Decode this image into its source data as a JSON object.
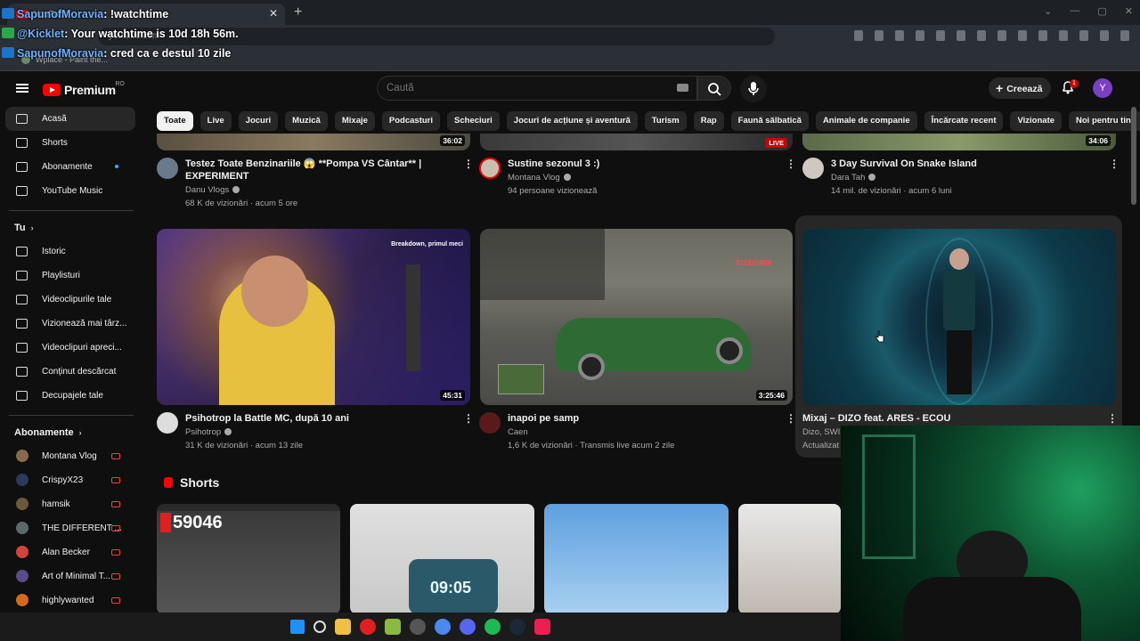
{
  "browser": {
    "tab_title": "YouTube",
    "new_tab": "+",
    "close_tab": "✕",
    "url": "youtube.com",
    "bookmark_label": "Wplace - Paint the..."
  },
  "chat": [
    {
      "user": "SapunofMoravia",
      "msg": ": !watchtime"
    },
    {
      "user": "@Kicklet",
      "msg": ": Your watchtime is 10d 18h 56m."
    },
    {
      "user": "SapunofMoravia",
      "msg": ": cred ca e destul 10 zile"
    }
  ],
  "header": {
    "logo_text": "Premium",
    "logo_region": "RO",
    "search_placeholder": "Caută",
    "create_label": "Creează",
    "notif_count": "1",
    "avatar_letter": "Y"
  },
  "chips": [
    "Toate",
    "Live",
    "Jocuri",
    "Muzică",
    "Mixaje",
    "Podcasturi",
    "Scheciuri",
    "Jocuri de acțiune și aventură",
    "Turism",
    "Rap",
    "Faună sălbatică",
    "Animale de companie",
    "Încărcate recent",
    "Vizionate",
    "Noi pentru tine"
  ],
  "sidebar": {
    "main": [
      {
        "label": "Acasă",
        "icon": "home-icon",
        "active": true
      },
      {
        "label": "Shorts",
        "icon": "shorts-icon"
      },
      {
        "label": "Abonamente",
        "icon": "subscriptions-icon",
        "dot": true
      },
      {
        "label": "YouTube Music",
        "icon": "youtube-music-icon"
      }
    ],
    "you_header": "Tu",
    "you": [
      {
        "label": "Istoric",
        "icon": "history-icon"
      },
      {
        "label": "Playlisturi",
        "icon": "playlists-icon"
      },
      {
        "label": "Videoclipurile tale",
        "icon": "your-videos-icon"
      },
      {
        "label": "Vizionează mai târz...",
        "icon": "watch-later-icon"
      },
      {
        "label": "Videoclipuri apreci...",
        "icon": "like-icon"
      },
      {
        "label": "Conținut descărcat",
        "icon": "download-icon"
      },
      {
        "label": "Decupajele tale",
        "icon": "clips-icon"
      }
    ],
    "subs_header": "Abonamente",
    "subs": [
      {
        "label": "Montana Vlog",
        "color": "#8a6a4a"
      },
      {
        "label": "CrispyX23",
        "color": "#2a3a5a"
      },
      {
        "label": "hamsik",
        "color": "#6a5a3a"
      },
      {
        "label": "THE DIFFERENT ...",
        "color": "#5a6a6a"
      },
      {
        "label": "Alan Becker",
        "color": "#d0453a"
      },
      {
        "label": "Art of Minimal T...",
        "color": "#5a4a8a"
      },
      {
        "label": "highlywanted",
        "color": "#d2691e"
      }
    ]
  },
  "videos_row1": [
    {
      "title": "Testez Toate Benzinariile 😱 **Pompa VS Cântar** | EXPERIMENT",
      "channel": "Danu Vlogs",
      "meta": "68 K de vizionări · acum 5 ore",
      "duration": "36:02",
      "verified": true
    },
    {
      "title": "Sustine sezonul 3 :)",
      "channel": "Montana Vlog",
      "meta": "94 persoane vizionează",
      "live": "LIVE",
      "verified": true
    },
    {
      "title": "3 Day Survival On Snake Island",
      "channel": "Dara Tah",
      "meta": "14 mil. de vizionări · acum 6 luni",
      "duration": "34:06",
      "verified": true
    }
  ],
  "videos_row2": [
    {
      "title": "Psihotrop la Battle MC, după 10 ani",
      "channel": "Psihotrop",
      "meta": "31 K de vizionări · acum 13 zile",
      "duration": "45:31",
      "overlay": "Breakdown, primul meci",
      "verified": true
    },
    {
      "title": "inapoi pe samp",
      "channel": "Caen",
      "meta": "1,6 K de vizionări · Transmis live acum 2 zile",
      "duration": "3:25:46",
      "overlay": "521929908"
    },
    {
      "title": "Mixaj – DIZO feat. ARES - ECOU",
      "channel": "Dizo, SWIS",
      "meta": "Actualizat"
    }
  ],
  "shorts": {
    "header": "Shorts",
    "items": [
      {
        "overlay": "59046"
      },
      {
        "overlay": "09:05"
      },
      {
        "overlay": ""
      },
      {
        "overlay": ""
      }
    ]
  },
  "colors": {
    "bg": "#0f0f0f",
    "accent_red": "#ff0000",
    "chip_bg": "#272727",
    "link_blue": "#3ea6ff"
  }
}
